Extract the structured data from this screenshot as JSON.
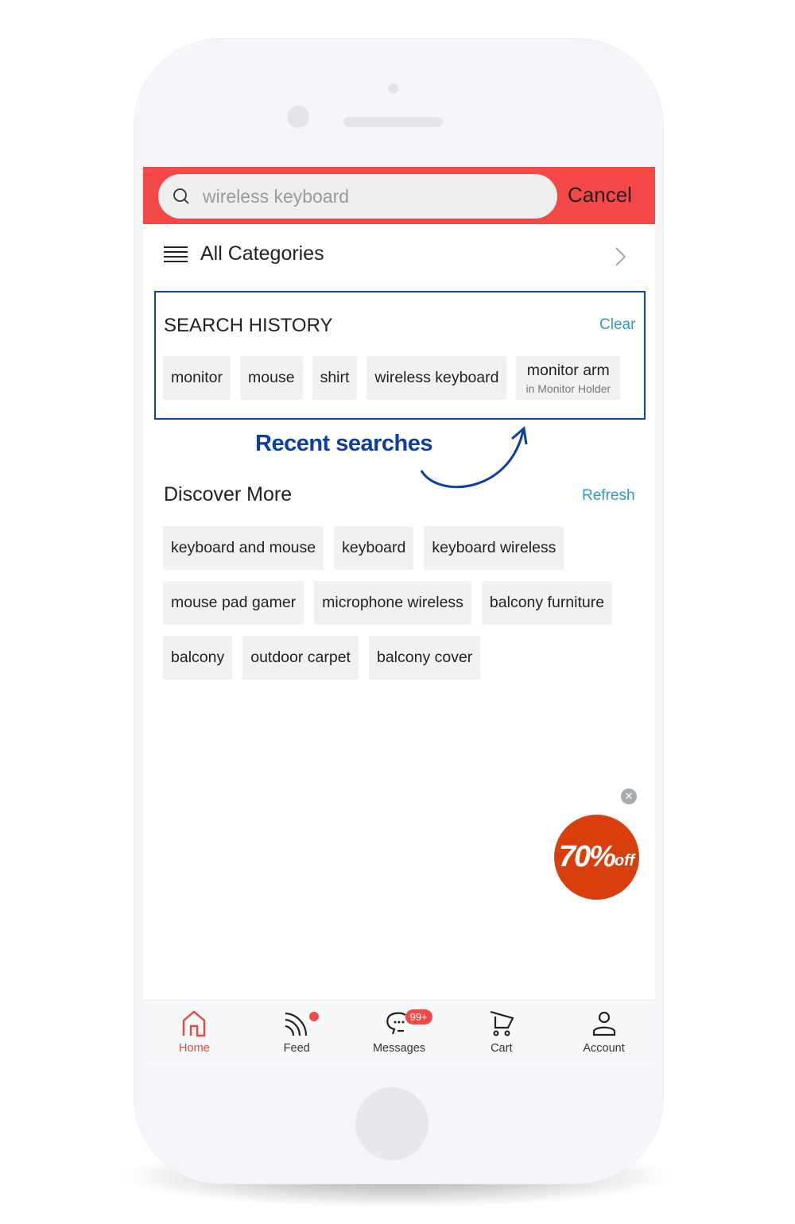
{
  "search": {
    "value": "wireless keyboard",
    "cancel": "Cancel"
  },
  "categories": {
    "label": "All Categories"
  },
  "history": {
    "title": "SEARCH HISTORY",
    "clear": "Clear",
    "chips": [
      {
        "label": "monitor"
      },
      {
        "label": "mouse"
      },
      {
        "label": "shirt"
      },
      {
        "label": "wireless keyboard"
      },
      {
        "label": "monitor arm",
        "sub": "in Monitor Holder"
      }
    ]
  },
  "annotation": "Recent searches",
  "discover": {
    "title": "Discover More",
    "refresh": "Refresh",
    "chips": [
      "keyboard and mouse",
      "keyboard",
      "keyboard wireless",
      "mouse pad gamer",
      "microphone wireless",
      "balcony furniture",
      "balcony",
      "outdoor carpet",
      "balcony cover"
    ]
  },
  "promo": {
    "big": "70%",
    "small": "off"
  },
  "tabs": [
    {
      "label": "Home",
      "icon": "home-icon"
    },
    {
      "label": "Feed",
      "icon": "feed-icon"
    },
    {
      "label": "Messages",
      "icon": "chat-icon",
      "badge": "99+"
    },
    {
      "label": "Cart",
      "icon": "cart-icon"
    },
    {
      "label": "Account",
      "icon": "user-icon"
    }
  ],
  "colors": {
    "header": "#f44848",
    "annotation": "#0e3ea0",
    "link": "#2aa0b4",
    "promo": "#d93f0c"
  }
}
